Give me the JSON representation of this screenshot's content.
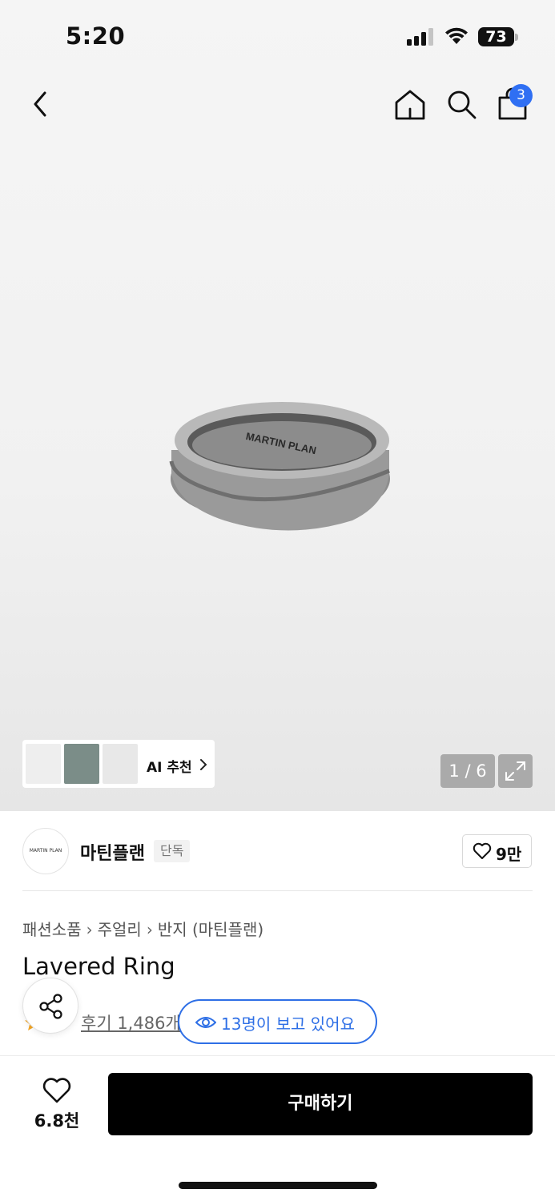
{
  "status_bar": {
    "time": "5:20",
    "battery": "73"
  },
  "nav": {
    "cart_count": "3",
    "icons": [
      "chevron-left-icon",
      "home-icon",
      "search-icon",
      "shopping-bag-icon"
    ]
  },
  "gallery": {
    "image_engraving": "MARTIN PLAN",
    "ai_recommend_label": "AI 추천",
    "counter": "1 / 6"
  },
  "brand": {
    "logo_text": "MARTIN PLAN",
    "name": "마틴플랜",
    "tag": "단독",
    "likes": "9만"
  },
  "breadcrumb": [
    "패션소품",
    "주얼리",
    "반지 (마틴플랜)"
  ],
  "product": {
    "title": "Lavered Ring",
    "review_link": "후기 1,486개",
    "viewers": "13명이 보고 있어요"
  },
  "bottom_bar": {
    "wishlist_count": "6.8천",
    "buy_label": "구매하기"
  },
  "colors": {
    "accent_blue": "#2e6fe6",
    "badge_blue": "#2f6ff3",
    "buy_button": "#000000",
    "star": "#f5a623"
  }
}
